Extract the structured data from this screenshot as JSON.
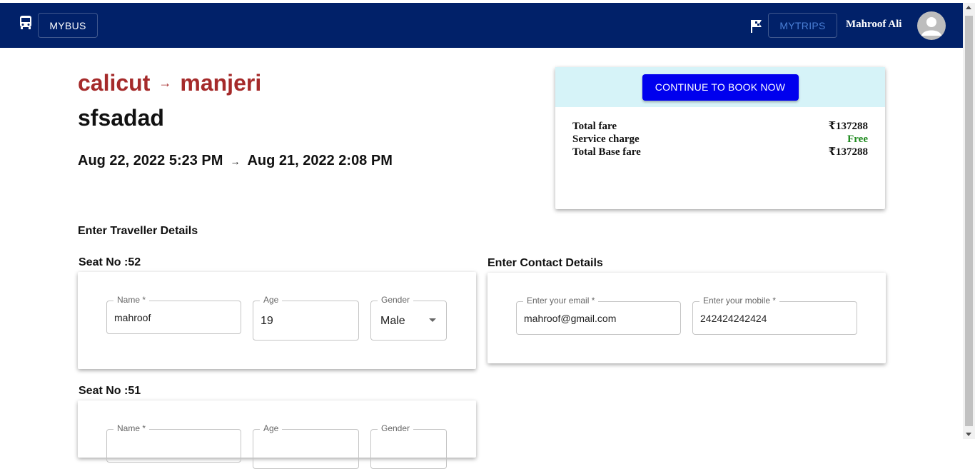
{
  "navbar": {
    "brand_label": "MYBUS",
    "trips_label": "MYTRIPS",
    "user_name": "Mahroof Ali",
    "colors": {
      "background": "#012169",
      "trips_text": "#4a7fd6"
    },
    "icons": [
      "bus-icon",
      "flag-icon",
      "avatar-icon"
    ]
  },
  "trip": {
    "from": "calicut",
    "to": "manjeri",
    "route_arrow": "→",
    "bus_name": "sfsadad",
    "departure": "Aug 22, 2022 5:23 PM",
    "arrival": "Aug 21, 2022 2:08 PM",
    "time_arrow": "→"
  },
  "fare": {
    "button_label": "CONTINUE TO BOOK NOW",
    "rows": [
      {
        "label": "Total fare",
        "value": "₹137288"
      },
      {
        "label": "Service charge",
        "value": "Free"
      },
      {
        "label": "Total Base fare",
        "value": "₹137288"
      }
    ]
  },
  "traveller": {
    "section_title": "Enter Traveller Details",
    "seats": [
      {
        "seat_label": "Seat No :52",
        "name_label": "Name *",
        "name_value": "mahroof",
        "age_label": "Age",
        "age_value": "19",
        "gender_label": "Gender",
        "gender_value": "Male"
      },
      {
        "seat_label": "Seat No :51",
        "name_label": "Name *",
        "name_value": "",
        "age_label": "Age",
        "age_value": "",
        "gender_label": "Gender",
        "gender_value": ""
      }
    ]
  },
  "contact": {
    "section_title": "Enter Contact Details",
    "email_label": "Enter your email *",
    "email_value": "mahroof@gmail.com",
    "mobile_label": "Enter your mobile *",
    "mobile_value": "242424242424"
  }
}
